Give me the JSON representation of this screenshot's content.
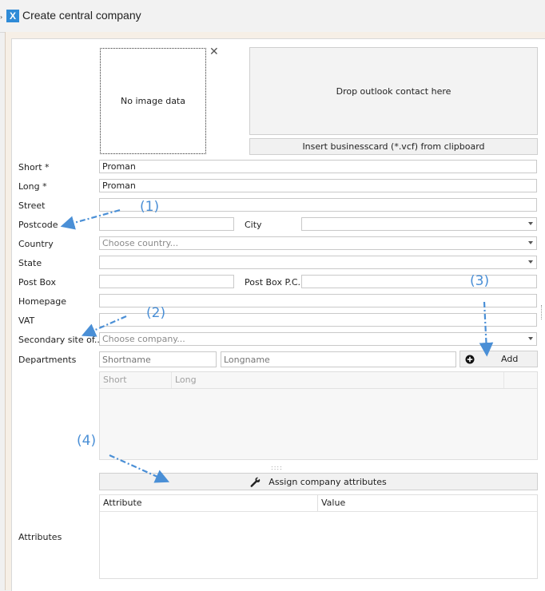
{
  "window": {
    "title": "Create central company",
    "app_icon": "X",
    "edge_glyph": "›"
  },
  "image": {
    "placeholder": "No image data",
    "close": "✕"
  },
  "drop_zone": {
    "text": "Drop outlook contact here"
  },
  "insert_card_button": "Insert businesscard (*.vcf) from clipboard",
  "fields": {
    "short": {
      "label": "Short *",
      "value": "Proman"
    },
    "long": {
      "label": "Long *",
      "value": "Proman"
    },
    "street": {
      "label": "Street",
      "value": ""
    },
    "postcode": {
      "label": "Postcode",
      "value": ""
    },
    "city": {
      "label": "City",
      "value": ""
    },
    "country": {
      "label": "Country",
      "placeholder": "Choose country..."
    },
    "state": {
      "label": "State",
      "value": ""
    },
    "post_box": {
      "label": "Post Box",
      "value": ""
    },
    "post_box_pc": {
      "label": "Post Box P.C.",
      "value": ""
    },
    "homepage": {
      "label": "Homepage",
      "value": ""
    },
    "vat": {
      "label": "VAT",
      "value": ""
    },
    "secondary_site": {
      "label": "Secondary site of...",
      "placeholder": "Choose company..."
    }
  },
  "departments": {
    "label": "Departments",
    "shortname_placeholder": "Shortname",
    "longname_placeholder": "Longname",
    "add_label": "Add",
    "columns": [
      "Short",
      "Long"
    ]
  },
  "assign_button": "Assign company attributes",
  "attributes": {
    "label": "Attributes",
    "columns": [
      "Attribute",
      "Value"
    ]
  },
  "annotations": [
    "(1)",
    "(2)",
    "(3)",
    "(4)"
  ],
  "colors": {
    "annotation": "#4a8fd6",
    "app_icon": "#2f8bd7"
  },
  "icons": {
    "app": "app-logo-icon",
    "close": "close-icon",
    "dropdown": "chevron-down-icon",
    "add": "plus-circle-icon",
    "assign": "wrench-icon",
    "splitter": "grip-icon"
  }
}
